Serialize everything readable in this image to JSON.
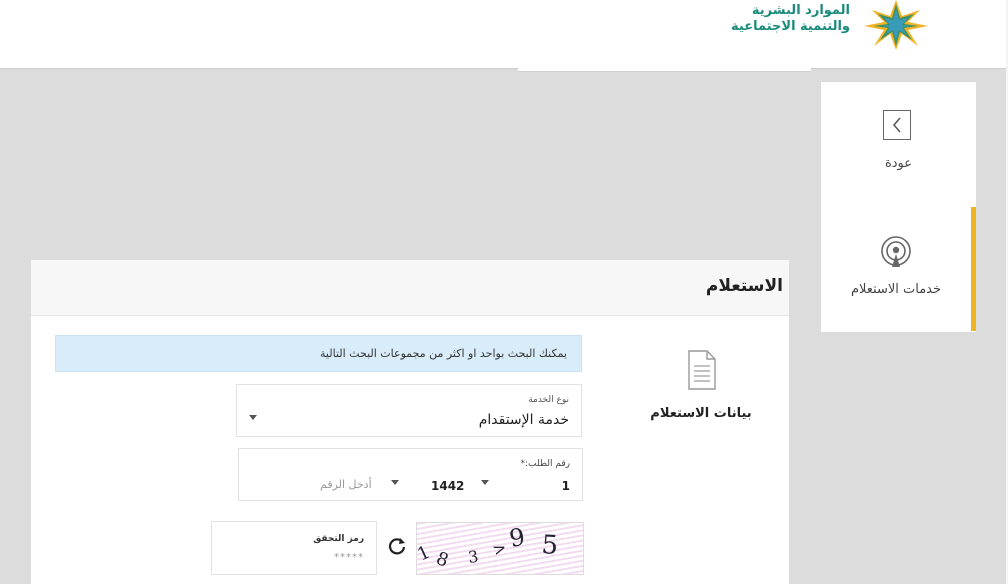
{
  "header": {
    "brand_line1": "الموارد البشرية",
    "brand_line2": "والتنمية الاجتماعية",
    "logo_icon": "ministry-star-logo"
  },
  "sidebar": {
    "items": [
      {
        "label": "عودة",
        "icon": "chevron-right-icon"
      },
      {
        "label": "خدمات الاستعلام",
        "icon": "broadcast-icon",
        "active": true
      }
    ]
  },
  "panel": {
    "title": "الاستعلام",
    "data_section_label": "بيانات الاستعلام",
    "info_text": "يمكنك البحث بواحد او اكثر من مجموعات البحث التالية",
    "service_type": {
      "label": "نوع الخدمة",
      "value": "خدمة الإستقدام"
    },
    "request_number": {
      "label": "رقم الطلب:*",
      "prefix": "1",
      "year": "1442",
      "placeholder": "أدخل الرقم"
    },
    "captcha": {
      "label": "رمز التحقق",
      "placeholder": "*****",
      "image_text": "95 > 3 81"
    }
  },
  "colors": {
    "accent": "#f0b323",
    "info_bg": "#d9ecf9",
    "brand": "#1a8a7a"
  }
}
